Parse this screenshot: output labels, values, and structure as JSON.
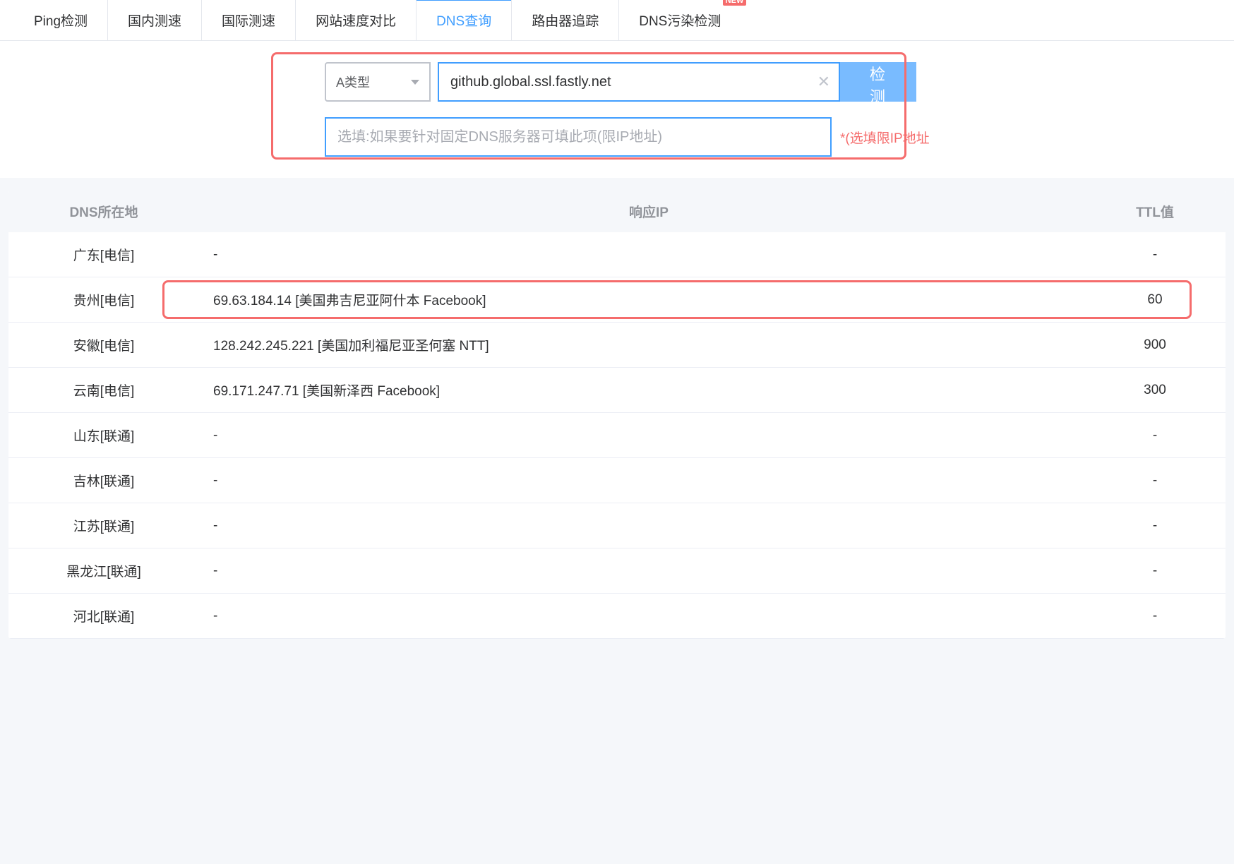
{
  "tabs": [
    {
      "label": "Ping检测",
      "active": false
    },
    {
      "label": "国内测速",
      "active": false
    },
    {
      "label": "国际测速",
      "active": false
    },
    {
      "label": "网站速度对比",
      "active": false
    },
    {
      "label": "DNS查询",
      "active": true
    },
    {
      "label": "路由器追踪",
      "active": false
    },
    {
      "label": "DNS污染检测",
      "active": false,
      "badge": "NEW"
    }
  ],
  "search": {
    "type_label": "A类型",
    "domain_value": "github.global.ssl.fastly.net",
    "button_label": "检 测",
    "dns_placeholder": "选填:如果要针对固定DNS服务器可填此项(限IP地址)",
    "hint": "*(选填限IP地址"
  },
  "table": {
    "headers": {
      "location": "DNS所在地",
      "ip": "响应IP",
      "ttl": "TTL值"
    },
    "rows": [
      {
        "location": "广东[电信]",
        "ip": "-",
        "ttl": "-",
        "highlighted": false
      },
      {
        "location": "贵州[电信]",
        "ip": "69.63.184.14 [美国弗吉尼亚阿什本 Facebook]",
        "ttl": "60",
        "highlighted": true
      },
      {
        "location": "安徽[电信]",
        "ip": "128.242.245.221 [美国加利福尼亚圣何塞 NTT]",
        "ttl": "900",
        "highlighted": false
      },
      {
        "location": "云南[电信]",
        "ip": "69.171.247.71 [美国新泽西 Facebook]",
        "ttl": "300",
        "highlighted": false
      },
      {
        "location": "山东[联通]",
        "ip": "-",
        "ttl": "-",
        "highlighted": false
      },
      {
        "location": "吉林[联通]",
        "ip": "-",
        "ttl": "-",
        "highlighted": false
      },
      {
        "location": "江苏[联通]",
        "ip": "-",
        "ttl": "-",
        "highlighted": false
      },
      {
        "location": "黑龙江[联通]",
        "ip": "-",
        "ttl": "-",
        "highlighted": false
      },
      {
        "location": "河北[联通]",
        "ip": "-",
        "ttl": "-",
        "highlighted": false
      }
    ]
  }
}
